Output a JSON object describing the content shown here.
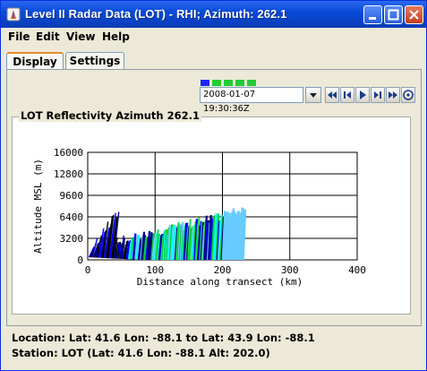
{
  "window": {
    "title": "Level II Radar Data (LOT) - RHI; Azimuth: 262.1",
    "controls": [
      "minimize",
      "maximize",
      "close"
    ]
  },
  "menu": {
    "items": [
      "File",
      "Edit",
      "View",
      "Help"
    ]
  },
  "tabs": [
    {
      "label": "Display",
      "active": true
    },
    {
      "label": "Settings",
      "active": false
    }
  ],
  "time_control": {
    "datetime": "2008-01-07 19:30:36Z",
    "timestep_colors": [
      "#1e26ff",
      "#22cc33",
      "#22cc33",
      "#22cc33",
      "#22cc33"
    ],
    "buttons": [
      "first-frame",
      "step-back",
      "play",
      "step-forward",
      "last-frame",
      "settings"
    ]
  },
  "panel": {
    "title": "LOT Reflectivity Azimuth 262.1"
  },
  "chart_data": {
    "type": "scatter",
    "title": "",
    "xlabel": "Distance along transect (km)",
    "ylabel": "Altitude MSL (m)",
    "xlim": [
      0,
      400
    ],
    "ylim": [
      0,
      16000
    ],
    "xticks": [
      "0",
      "100",
      "200",
      "300",
      "400"
    ],
    "yticks": [
      "0",
      "3200",
      "6400",
      "9600",
      "12800",
      "16000"
    ],
    "grid": true,
    "colors": [
      "#000080",
      "#0000ff",
      "#00cc33",
      "#22dd55",
      "#66ccff",
      "#00ffff",
      "#ffffff",
      "#000000"
    ]
  },
  "status": {
    "location": "Location: Lat: 41.6 Lon: -88.1  to  Lat: 43.9 Lon: -88.1",
    "station": "Station: LOT  (Lat: 41.6 Lon: -88.1 Alt: 202.0)"
  }
}
